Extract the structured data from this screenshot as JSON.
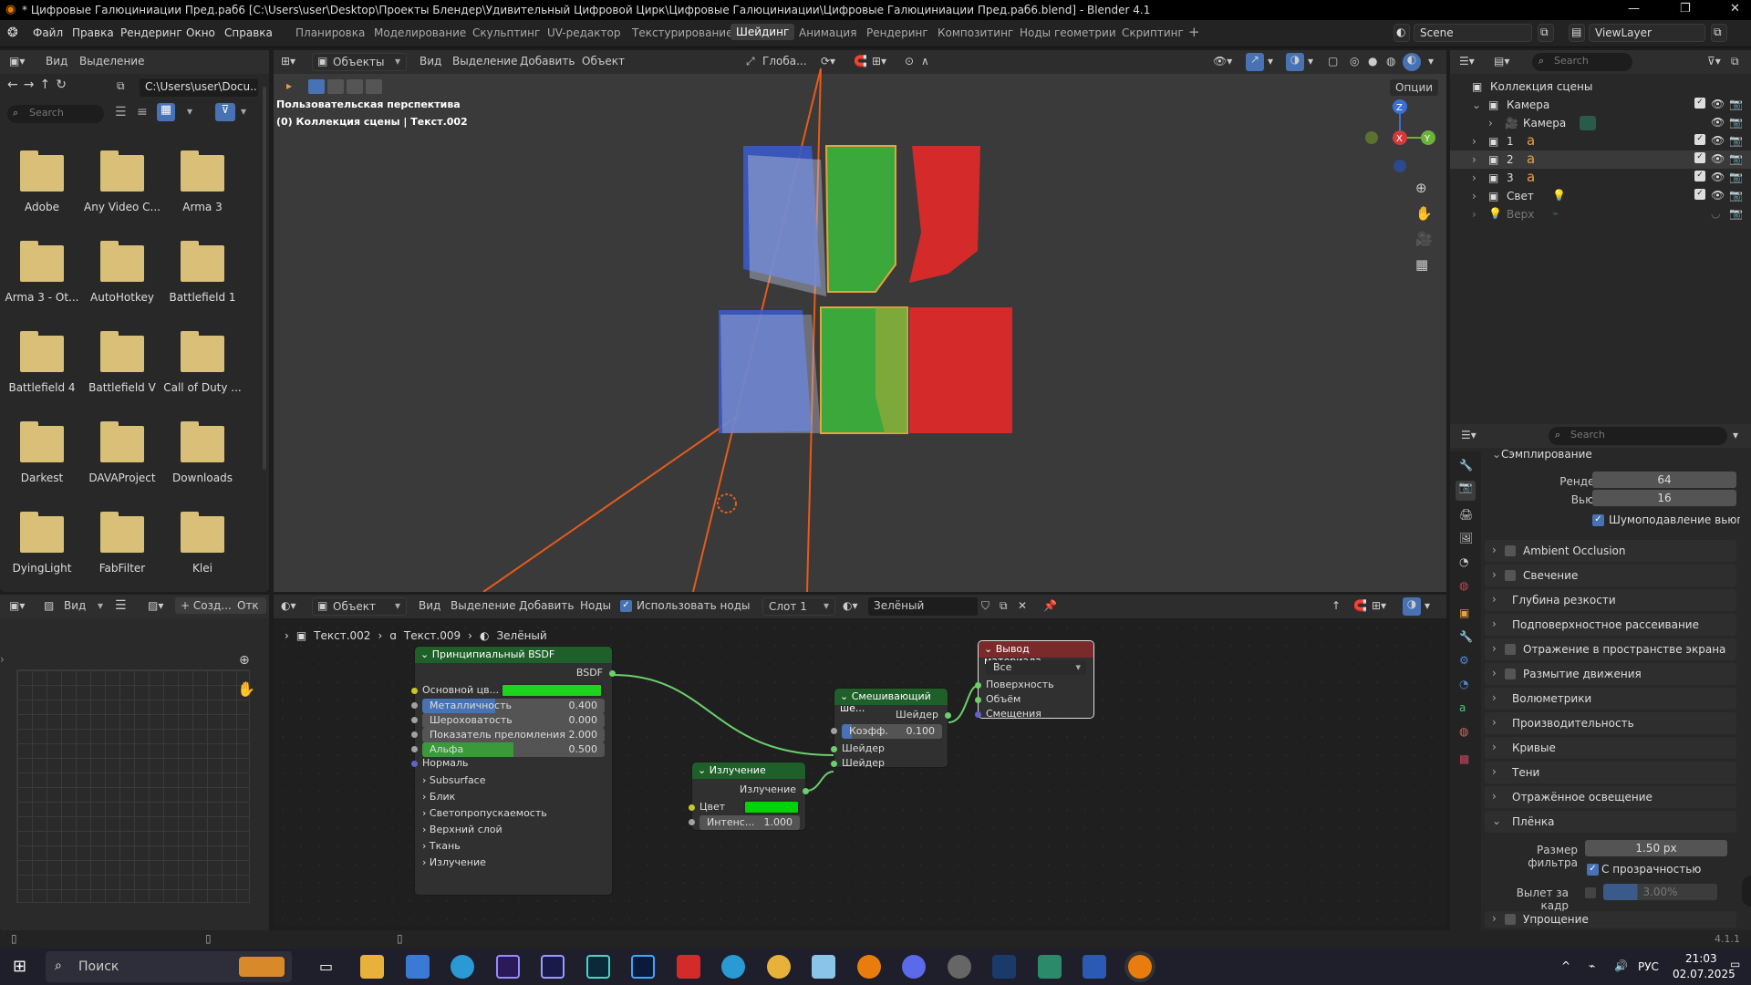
{
  "title_bar": {
    "text": "* Цифровые Галюциниации Пред.раб6 [C:\\Users\\user\\Desktop\\Проекты Блендер\\Удивительный Цифровой Цирк\\Цифровые Галюциниации\\Цифровые Галюциниации Пред.раб6.blend] - Blender 4.1"
  },
  "menu": {
    "file": "Файл",
    "edit": "Правка",
    "render": "Рендеринг",
    "window": "Окно",
    "help": "Справка"
  },
  "workspaces": [
    "Планировка",
    "Моделирование",
    "Скульптинг",
    "UV-редактор",
    "Текстурирование",
    "Шейдинг",
    "Анимация",
    "Рендеринг",
    "Композитинг",
    "Ноды геометрии",
    "Скриптинг"
  ],
  "active_workspace": "Шейдинг",
  "scene": "Scene",
  "view_layer": "ViewLayer",
  "file_browser": {
    "view": "Вид",
    "select": "Выделение",
    "path": "C:\\Users\\user\\Docu...",
    "search_placeholder": "Search",
    "folders": [
      "Adobe",
      "Any Video C...",
      "Arma 3",
      "Arma 3 - Ot...",
      "AutoHotkey",
      "Battlefield 1",
      "Battlefield 4",
      "Battlefield V",
      "Call of Duty ...",
      "Darkest",
      "DAVAProject",
      "Downloads",
      "DyingLight",
      "FabFilter",
      "Klei"
    ]
  },
  "viewport": {
    "mode": "Объекты",
    "view": "Вид",
    "select": "Выделение",
    "add": "Добавить",
    "object": "Объект",
    "orientation": "Глоба...",
    "options": "Опции",
    "perspective": "Пользовательская перспектива",
    "collection": "(0) Коллекция сцены | Текст.002",
    "axis_x": "X",
    "axis_y": "Y",
    "axis_z": "Z"
  },
  "image_editor": {
    "view": "Вид",
    "new": "+ Созд...",
    "open": "Отк"
  },
  "node_header": {
    "mode": "Объект",
    "view": "Вид",
    "select": "Выделение",
    "add": "Добавить",
    "nodes": "Ноды",
    "use_nodes": "Использовать ноды",
    "slot": "Слот 1",
    "material": "Зелёный"
  },
  "breadcrumb": {
    "obj": "Текст.002",
    "data": "Текст.009",
    "mat": "Зелёный"
  },
  "bsdf": {
    "title": "Принципиальный BSDF",
    "out": "BSDF",
    "base_color": "Основной цв...",
    "metallic": "Металличность",
    "metallic_v": "0.400",
    "roughness": "Шероховатость",
    "roughness_v": "0.000",
    "ior": "Показатель преломления",
    "ior_v": "2.000",
    "alpha": "Альфа",
    "alpha_v": "0.500",
    "normal": "Нормаль",
    "subs": [
      "Subsurface",
      "Блик",
      "Светопропускаемость",
      "Верхний слой",
      "Ткань",
      "Излучение"
    ]
  },
  "emission": {
    "title": "Излучение",
    "out": "Излучение",
    "color": "Цвет",
    "strength": "Интенс...",
    "strength_v": "1.000"
  },
  "mix": {
    "title": "Смешивающий ше...",
    "out": "Шейдер",
    "fac": "Коэфф.",
    "fac_v": "0.100",
    "in1": "Шейдер",
    "in2": "Шейдер"
  },
  "output": {
    "title": "Вывод материала",
    "target": "Все",
    "surface": "Поверхность",
    "volume": "Объём",
    "displacement": "Смещения"
  },
  "outliner": {
    "search": "Search",
    "root": "Коллекция сцены",
    "rows": [
      "Камера",
      "Камера",
      "1",
      "2",
      "3",
      "Свет",
      "Верх"
    ]
  },
  "properties": {
    "search": "Search",
    "sampling": "Сэмплирование",
    "render_label": "Рендеринг",
    "render_v": "64",
    "viewport_label": "Вьюпорт",
    "viewport_v": "16",
    "denoise": "Шумоподавление вьюп...",
    "sections": [
      "Ambient Occlusion",
      "Свечение",
      "Глубина резкости",
      "Подповерхностное рассеивание",
      "Отражение в пространстве экрана",
      "Размытие движения",
      "Волюметрики",
      "Производительность",
      "Кривые",
      "Тени",
      "Отражённое освещение",
      "Плёнка"
    ],
    "filter_size": "Размер фильтра",
    "filter_size_v": "1.50 px",
    "transparent": "С прозрачностью",
    "overscan": "Вылет за кадр",
    "overscan_v": "3.00%",
    "simplify": "Упрощение"
  },
  "status": {
    "version": "4.1.1"
  },
  "taskbar": {
    "search": "Поиск",
    "lang": "РУС",
    "time": "21:03",
    "date": "02.07.2025"
  },
  "colors": {
    "accent": "#4772b3",
    "node_green": "#1f5f2a",
    "emission_green": "#00d400",
    "active_border": "#e8a040"
  }
}
